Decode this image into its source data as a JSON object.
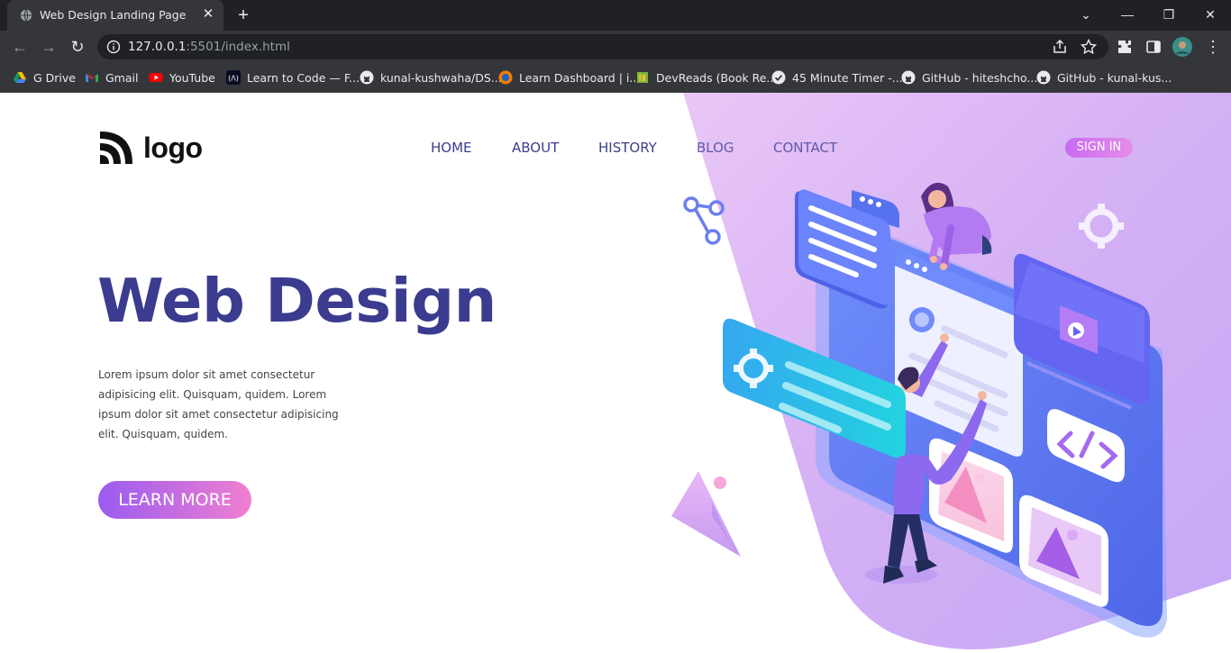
{
  "browser": {
    "tab_title": "Web Design Landing Page",
    "tab_close": "✕",
    "new_tab": "+",
    "url_host": "127.0.0.1",
    "url_rest": ":5501/index.html",
    "bookmarks": [
      {
        "label": "G Drive",
        "icon": "google-drive-icon"
      },
      {
        "label": "Gmail",
        "icon": "gmail-icon"
      },
      {
        "label": "YouTube",
        "icon": "youtube-icon"
      },
      {
        "label": "Learn to Code — F...",
        "icon": "freecodecamp-icon"
      },
      {
        "label": "kunal-kushwaha/DS...",
        "icon": "github-icon"
      },
      {
        "label": "Learn Dashboard | i...",
        "icon": "dashboard-icon"
      },
      {
        "label": "DevReads (Book Re...",
        "icon": "book-icon"
      },
      {
        "label": "45 Minute Timer -...",
        "icon": "timer-icon"
      },
      {
        "label": "GitHub - hiteshcho...",
        "icon": "github-icon"
      },
      {
        "label": "GitHub - kunal-kus...",
        "icon": "github-icon"
      }
    ]
  },
  "site": {
    "logo": "logo",
    "nav": [
      "HOME",
      "ABOUT",
      "HISTORY",
      "BLOG",
      "CONTACT"
    ],
    "signin": "SIGN IN",
    "hero_title": "Web Design",
    "hero_text": "Lorem ipsum dolor sit amet consectetur adipisicing elit. Quisquam, quidem. Lorem ipsum dolor sit amet consectetur adipisicing elit. Quisquam, quidem.",
    "cta": "LEARN MORE"
  },
  "colors": {
    "accent": "#3b3b8f",
    "gradient_start": "#9a5bf0",
    "gradient_end": "#f07fd0",
    "chrome_bg": "#202124"
  }
}
